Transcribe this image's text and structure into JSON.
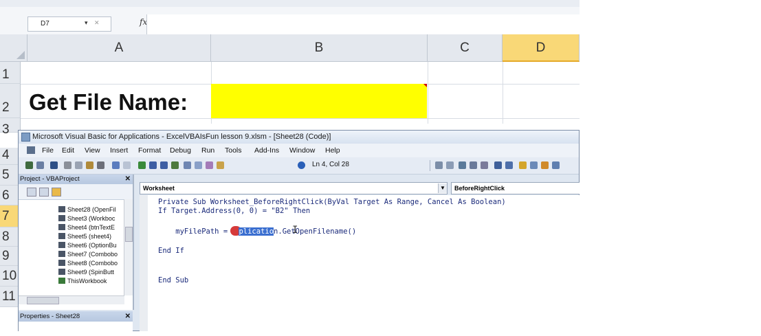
{
  "excel": {
    "name_box": "D7",
    "fx_symbol": "fx",
    "formula_value": "",
    "columns": [
      "A",
      "B",
      "C",
      "D"
    ],
    "selected_column": "D",
    "rows": [
      "1",
      "2",
      "3",
      "4",
      "5",
      "6",
      "7",
      "8",
      "9",
      "10",
      "11"
    ],
    "selected_row": "7",
    "cell_A2": "Get File Name:",
    "cell_B2_fill": "#ffff00"
  },
  "vbe": {
    "title": "Microsoft Visual Basic for Applications - ExcelVBAIsFun lesson 9.xlsm - [Sheet28 (Code)]",
    "menu": [
      "File",
      "Edit",
      "View",
      "Insert",
      "Format",
      "Debug",
      "Run",
      "Tools",
      "Add-Ins",
      "Window",
      "Help"
    ],
    "cursor_position": "Ln 4, Col 28",
    "project_pane_title": "Project - VBAProject",
    "tree_items": [
      "Sheet28 (OpenFil",
      "Sheet3 (Workboc",
      "Sheet4 (btnTextE",
      "Sheet5 (sheet4)",
      "Sheet6 (OptionBu",
      "Sheet7 (Combobo",
      "Sheet8 (Combobo",
      "Sheet9 (SpinButt",
      "ThisWorkbook"
    ],
    "properties_title": "Properties - Sheet28",
    "object_dropdown": "Worksheet",
    "procedure_dropdown": "BeforeRightClick",
    "code": {
      "line1": "Private Sub Worksheet_BeforeRightClick(ByVal Target As Range, Cancel As Boolean)",
      "line2": "If Target.Address(0, 0) = \"B2\" Then",
      "line3_prefix": "    myFilePath = ",
      "line3_selected": "plicatio",
      "line3_suffix": "n.GetOpenFilename()",
      "line4": "End If",
      "line5": "End Sub"
    },
    "accent_selection": "#3b6fd0"
  }
}
